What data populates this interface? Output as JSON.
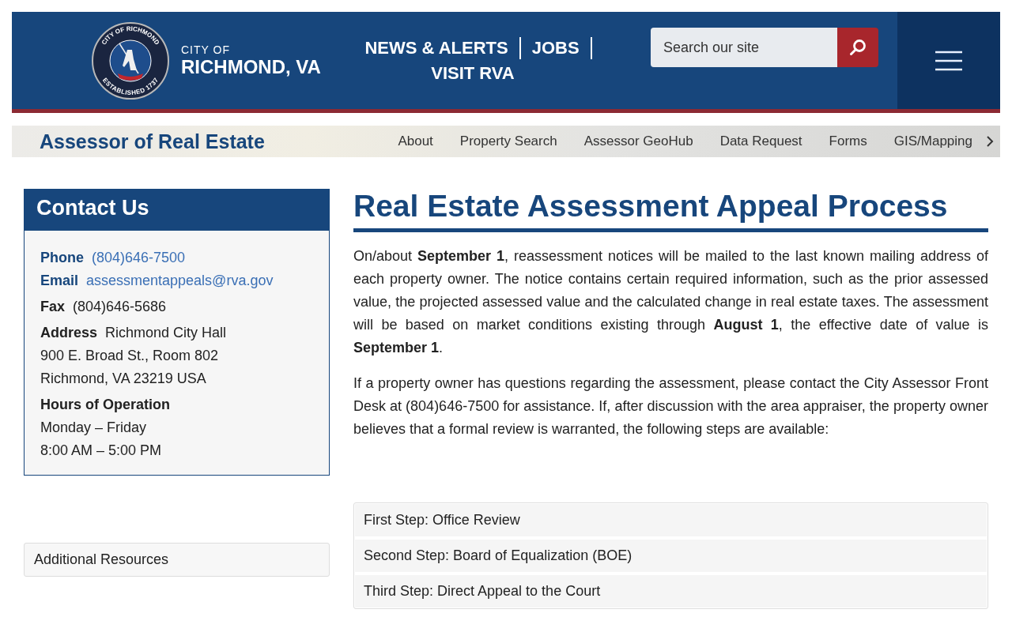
{
  "header": {
    "seal": {
      "top_text": "CITY OF RICHMOND",
      "bottom_text": "ESTABLISHED 1737"
    },
    "city_small": "CITY OF",
    "city_large": "RICHMOND, VA",
    "links": [
      "NEWS & ALERTS",
      "JOBS",
      "VISIT RVA"
    ],
    "search": {
      "placeholder": "Search our site"
    }
  },
  "subnav": {
    "title": "Assessor of Real Estate",
    "items": [
      "About",
      "Property Search",
      "Assessor GeoHub",
      "Data Request",
      "Forms",
      "GIS/Mapping"
    ]
  },
  "contact": {
    "title": "Contact Us",
    "entries": [
      {
        "kind": "link",
        "label": "Phone",
        "value": "(804)646-7500"
      },
      {
        "kind": "link",
        "label": "Email",
        "value": "assessmentappeals@rva.gov"
      },
      {
        "kind": "text",
        "label": "Fax",
        "value": "(804)646-5686"
      },
      {
        "kind": "text",
        "label": "Address",
        "value": "Richmond City Hall"
      },
      {
        "kind": "line",
        "value": "900 E. Broad St., Room 802"
      },
      {
        "kind": "line",
        "value": "Richmond, VA 23219 USA"
      },
      {
        "kind": "heading",
        "label": "Hours of Operation"
      },
      {
        "kind": "line",
        "value": "Monday – Friday"
      },
      {
        "kind": "line",
        "value": "8:00 AM – 5:00 PM"
      }
    ]
  },
  "additional_resources": "Additional Resources",
  "page_title": "Real Estate Assessment Appeal Process",
  "paragraphs": [
    "On/about **September 1**, reassessment notices will be mailed to the last known mailing address of each property owner. The notice contains certain required information, such as the prior assessed value, the projected assessed value and the calculated change in real estate taxes. The assessment will be based on market conditions existing through **August 1**, the effective date of value is **September 1**.",
    "If a property owner has questions regarding the assessment, please contact the City Assessor Front Desk at (804)646-7500 for assistance. If, after discussion with the area appraiser, the property owner believes that a formal review is warranted, the following steps are available:"
  ],
  "steps": [
    {
      "label": "First Step: Office Review",
      "expanded": false
    },
    {
      "label": "Second Step: Board of Equalization (BOE)",
      "expanded": false
    },
    {
      "label": "Third Step: Direct Appeal to the Court",
      "expanded": false
    }
  ]
}
